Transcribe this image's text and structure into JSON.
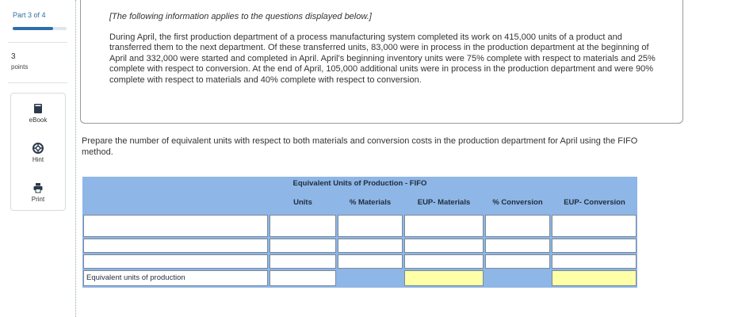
{
  "rail": {
    "part": "Part 3 of 4",
    "part_progress": 0.75,
    "points_value": "3",
    "points_label": "points",
    "tools": [
      {
        "label": "eBook",
        "icon": "book-icon"
      },
      {
        "label": "Hint",
        "icon": "lifebuoy-icon"
      },
      {
        "label": "Print",
        "icon": "printer-icon"
      }
    ]
  },
  "info": {
    "heading": "[The following information applies to the questions displayed below.]",
    "body": "During April, the first production department of a process manufacturing system completed its work on 415,000 units of a product and transferred them to the next department. Of these transferred units, 83,000 were in process in the production department at the beginning of April and 332,000 were started and completed in April. April's beginning inventory units were 75% complete with respect to materials and 25% complete with respect to conversion. At the end of April, 105,000 additional units were in process in the production department and were 90% complete with respect to materials and 40% complete with respect to conversion."
  },
  "prompt": "Prepare the number of equivalent units with respect to both materials and conversion costs in the production department for April using the FIFO method.",
  "table": {
    "title": "Equivalent Units of Production - FIFO",
    "columns": [
      "Units",
      "% Materials",
      "EUP- Materials",
      "% Conversion",
      "EUP- Conversion"
    ],
    "total_label": "Equivalent units of production",
    "highlight_color": "#ffffa8",
    "header_color": "#8eb6e6"
  }
}
